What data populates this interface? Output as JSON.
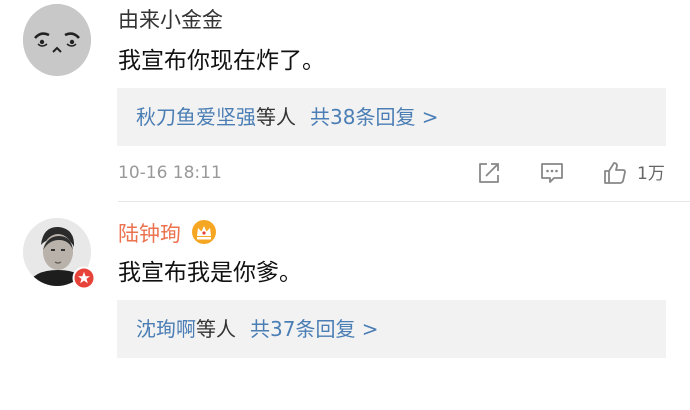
{
  "comments": [
    {
      "username": "由来小金金",
      "text": "我宣布你现在炸了。",
      "replies": {
        "names": "秋刀鱼爱坚强",
        "suffix": "等人",
        "count_text": "共38条回复 >"
      },
      "timestamp": "10-16 18:11",
      "likes": "1万"
    },
    {
      "username": "陆钟珣",
      "text": "我宣布我是你爹。",
      "replies": {
        "names": "沈珣啊",
        "suffix": "等人",
        "count_text": "共37条回复 >"
      }
    }
  ],
  "colors": {
    "link_blue": "#4b7eb5",
    "vip_name": "#eb7350",
    "reply_bg": "#f2f2f2",
    "meta_gray": "#999999"
  },
  "icons": [
    "share-icon",
    "comment-icon",
    "thumbs-up-icon",
    "crown-icon",
    "verified-badge-icon"
  ]
}
